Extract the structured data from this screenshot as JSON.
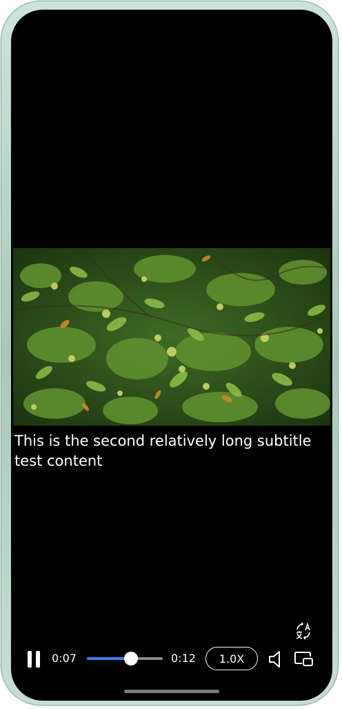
{
  "player": {
    "state": "playing",
    "current_time": "0:07",
    "total_time": "0:12",
    "progress_fraction": 0.58,
    "speed_label": "1.0X",
    "accent_color": "#3d7cf2"
  },
  "subtitle": {
    "text": "This is the second relatively long subtitle test content"
  },
  "icons": {
    "pause": "pause-icon",
    "volume": "speaker-icon",
    "translate": "translate-icon",
    "window": "picture-in-picture-icon"
  }
}
